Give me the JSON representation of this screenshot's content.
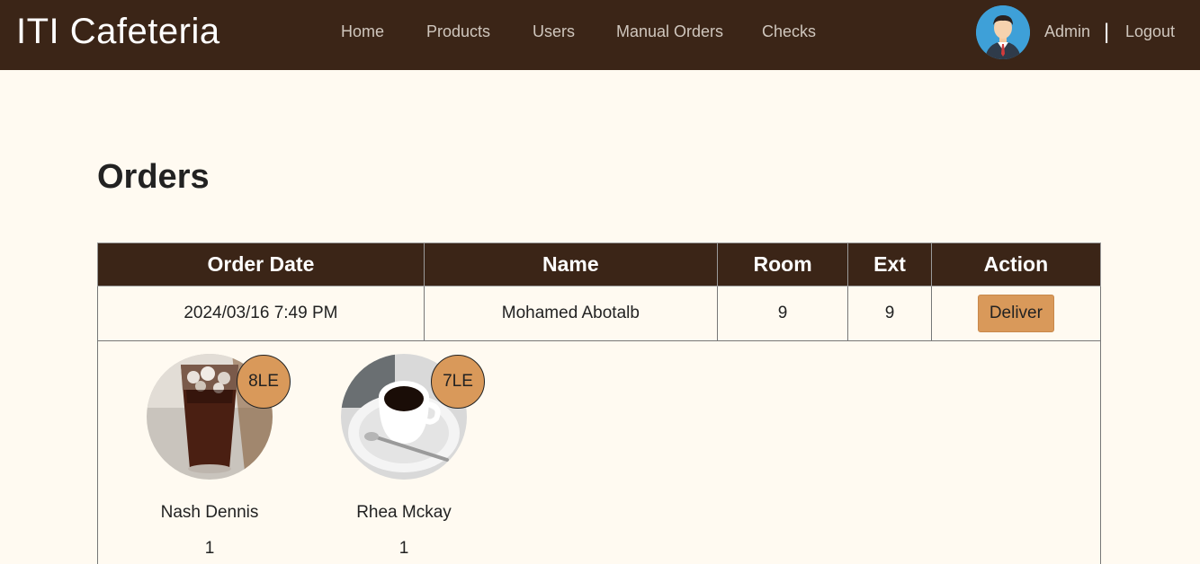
{
  "navbar": {
    "brand": "ITI Cafeteria",
    "links": [
      "Home",
      "Products",
      "Users",
      "Manual Orders",
      "Checks"
    ],
    "user_name": "Admin",
    "separator": "|",
    "logout": "Logout"
  },
  "page": {
    "title": "Orders"
  },
  "table": {
    "headers": [
      "Order Date",
      "Name",
      "Room",
      "Ext",
      "Action"
    ],
    "rows": [
      {
        "date": "2024/03/16 7:49 PM",
        "name": "Mohamed Abotalb",
        "room": "9",
        "ext": "9",
        "action": "Deliver"
      }
    ]
  },
  "order_items": [
    {
      "name": "Nash Dennis",
      "price": "8LE",
      "quantity": "1",
      "image": "iced-drink-image"
    },
    {
      "name": "Rhea Mckay",
      "price": "7LE",
      "quantity": "1",
      "image": "coffee-cup-image"
    }
  ],
  "colors": {
    "navbar_bg": "#3b2517",
    "page_bg": "#fffaf1",
    "accent": "#d9995a"
  }
}
